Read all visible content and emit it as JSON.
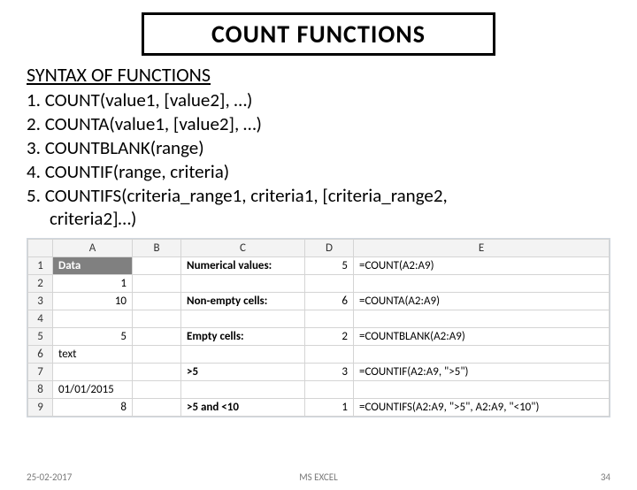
{
  "title": "COUNT  FUNCTIONS",
  "subtitle": "SYNTAX OF FUNCTIONS",
  "syntax": [
    "1. COUNT(value1, [value2], …)",
    "2. COUNTA(value1, [value2], …)",
    "3. COUNTBLANK(range)",
    "4. COUNTIF(range, criteria)",
    "5. COUNTIFS(criteria_range1, criteria1, [criteria_range2,",
    "criteria2]…)"
  ],
  "excel": {
    "cols": [
      "A",
      "B",
      "C",
      "D",
      "E"
    ],
    "rows": [
      "1",
      "2",
      "3",
      "4",
      "5",
      "6",
      "7",
      "8",
      "9"
    ],
    "cells": {
      "A1": "Data",
      "C1": "Numerical values:",
      "D1": "5",
      "E1": "=COUNT(A2:A9)",
      "A2": "1",
      "A3": "10",
      "C3": "Non-empty cells:",
      "D3": "6",
      "E3": "=COUNTA(A2:A9)",
      "A5": "5",
      "C5": "Empty cells:",
      "D5": "2",
      "E5": "=COUNTBLANK(A2:A9)",
      "A6": "text",
      "C7": ">5",
      "D7": "3",
      "E7": "=COUNTIF(A2:A9, \">5\")",
      "A8": "01/01/2015",
      "A9": "8",
      "C9": ">5 and <10",
      "D9": "1",
      "E9": "=COUNTIFS(A2:A9, \">5\", A2:A9, \"<10\")"
    }
  },
  "footer": {
    "date": "25-02-2017",
    "center": "MS EXCEL",
    "page": "34"
  }
}
